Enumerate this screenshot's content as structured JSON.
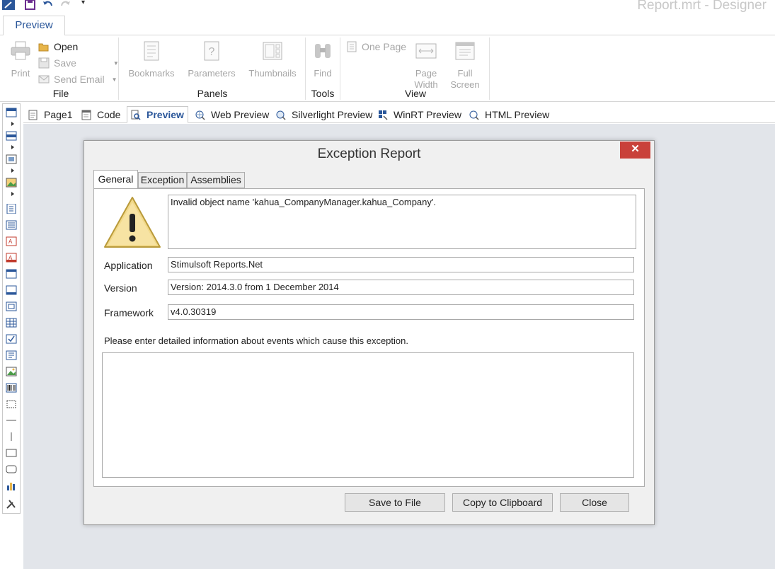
{
  "window": {
    "title": "Report.mrt  - Designer"
  },
  "ribbon": {
    "tab": "Preview",
    "file_group": {
      "label": "File",
      "print": "Print",
      "open": "Open",
      "save": "Save",
      "send_email": "Send Email"
    },
    "panels_group": {
      "label": "Panels",
      "bookmarks": "Bookmarks",
      "parameters": "Parameters",
      "thumbnails": "Thumbnails"
    },
    "tools_group": {
      "label": "Tools",
      "find": "Find"
    },
    "view_group": {
      "label": "View",
      "one_page": "One Page",
      "page_width_1": "Page",
      "page_width_2": "Width",
      "full_screen_1": "Full",
      "full_screen_2": "Screen"
    }
  },
  "page_tabs": [
    "Page1",
    "Code",
    "Preview",
    "Web Preview",
    "Silverlight Preview",
    "WinRT Preview",
    "HTML Preview"
  ],
  "dialog": {
    "title": "Exception Report",
    "close_glyph": "✕",
    "tabs": [
      "General",
      "Exception",
      "Assemblies"
    ],
    "message": "Invalid object name 'kahua_CompanyManager.kahua_Company'.",
    "application_label": "Application",
    "application_value": "Stimulsoft Reports.Net",
    "version_label": "Version",
    "version_value": "Version: 2014.3.0 from 1 December 2014",
    "framework_label": "Framework",
    "framework_value": "v4.0.30319",
    "details_prompt": "Please enter detailed information about events which cause this exception.",
    "details_value": "",
    "buttons": {
      "save": "Save to File",
      "copy": "Copy to Clipboard",
      "close": "Close"
    }
  },
  "colors": {
    "accent": "#2b579a",
    "close_red": "#c9413a",
    "workspace": "#e2e5ea"
  }
}
